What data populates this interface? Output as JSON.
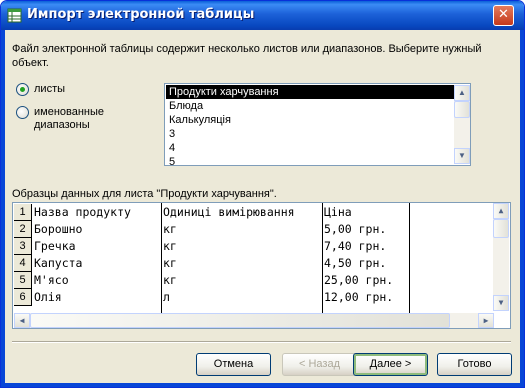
{
  "window": {
    "title": "Импорт электронной таблицы",
    "close_glyph": "✕",
    "accent": "#0a5fd8"
  },
  "description": "Файл электронной таблицы содержит несколько листов или диапазонов.  Выберите нужный объект.",
  "options": {
    "sheets_label": "листы",
    "ranges_label_line1": "именованные",
    "ranges_label_line2": "диапазоны",
    "selected": "sheets"
  },
  "sheet_list": {
    "items": [
      "Продукти харчування",
      "Блюда",
      "Калькуляція",
      "3",
      "4",
      "5"
    ],
    "selected_index": 0
  },
  "sample_label": "Образцы данных для листа \"Продукти харчування\".",
  "sample_grid": {
    "row_numbers": [
      "1",
      "2",
      "3",
      "4",
      "5",
      "6"
    ],
    "rows": [
      [
        "Назва продукту",
        "Одиниці вимірювання",
        "Ціна"
      ],
      [
        "Борошно",
        "кг",
        "5,00 грн."
      ],
      [
        "Гречка",
        "кг",
        "7,40 грн."
      ],
      [
        "Капуста",
        "кг",
        "4,50 грн."
      ],
      [
        "М'ясо",
        "кг",
        "25,00 грн."
      ],
      [
        "Олія",
        "л",
        "12,00 грн."
      ]
    ]
  },
  "buttons": {
    "cancel": "Отмена",
    "back": "< Назад",
    "next": "Далее >",
    "finish": "Готово"
  },
  "icons": {
    "scroll_up": "▲",
    "scroll_down": "▼",
    "scroll_left": "◀",
    "scroll_right": "▶"
  }
}
